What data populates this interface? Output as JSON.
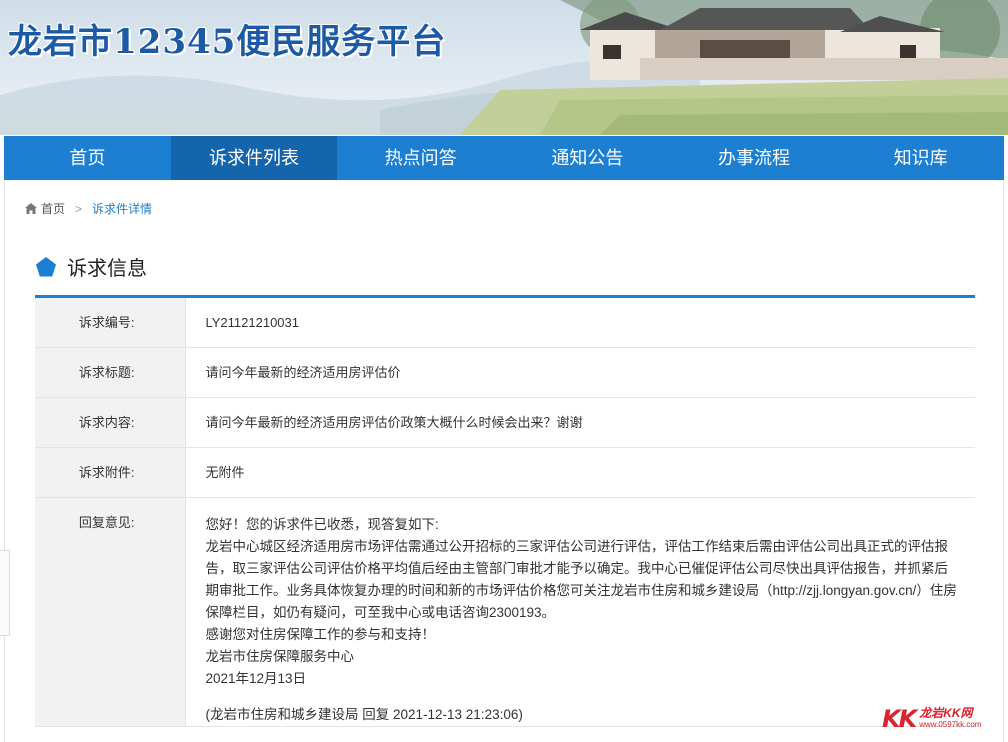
{
  "site": {
    "title": "龙岩市12345便民服务平台"
  },
  "nav": [
    {
      "label": "首页",
      "active": false
    },
    {
      "label": "诉求件列表",
      "active": true
    },
    {
      "label": "热点问答",
      "active": false
    },
    {
      "label": "通知公告",
      "active": false
    },
    {
      "label": "办事流程",
      "active": false
    },
    {
      "label": "知识库",
      "active": false
    }
  ],
  "breadcrumb": {
    "home": "首页",
    "current": "诉求件详情"
  },
  "section": {
    "title": "诉求信息"
  },
  "detail": {
    "rows": [
      {
        "label": "诉求编号:",
        "value": "LY21121210031"
      },
      {
        "label": "诉求标题:",
        "value": "请问今年最新的经济适用房评估价"
      },
      {
        "label": "诉求内容:",
        "value": "请问今年最新的经济适用房评估价政策大概什么时候会出来？谢谢"
      },
      {
        "label": "诉求附件:",
        "value": "无附件"
      }
    ],
    "reply": {
      "label": "回复意见:",
      "lines": [
        "您好！您的诉求件已收悉，现答复如下:",
        "龙岩中心城区经济适用房市场评估需通过公开招标的三家评估公司进行评估，评估工作结束后需由评估公司出具正式的评估报告，取三家评估公司评估价格平均值后经由主管部门审批才能予以确定。我中心已催促评估公司尽快出具评估报告，并抓紧后期审批工作。业务具体恢复办理的时间和新的市场评估价格您可关注龙岩市住房和城乡建设局（http://zjj.longyan.gov.cn/）住房保障栏目，如仍有疑问，可至我中心或电话咨询2300193。",
        "感谢您对住房保障工作的参与和支持！",
        "龙岩市住房保障服务中心",
        "2021年12月13日"
      ],
      "signature": "(龙岩市住房和城乡建设局 回复 2021-12-13 21:23:06)"
    }
  },
  "watermark": {
    "brand": "KK",
    "name": "龙岩KK网",
    "url": "www.0597kk.com"
  },
  "colors": {
    "primary": "#1c7fd1",
    "nav_active": "#1565ad",
    "watermark": "#d9232d"
  }
}
